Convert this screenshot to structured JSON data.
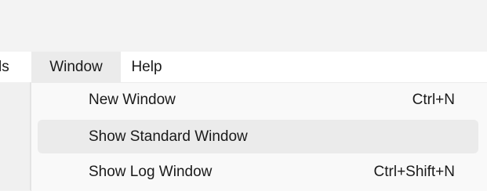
{
  "menubar": {
    "items": [
      {
        "label": "ls"
      },
      {
        "label": "Window"
      },
      {
        "label": "Help"
      }
    ]
  },
  "window_menu": {
    "items": [
      {
        "label": "New Window",
        "shortcut": "Ctrl+N"
      },
      {
        "label": "Show Standard Window",
        "shortcut": ""
      },
      {
        "label": "Show Log Window",
        "shortcut": "Ctrl+Shift+N"
      }
    ]
  }
}
